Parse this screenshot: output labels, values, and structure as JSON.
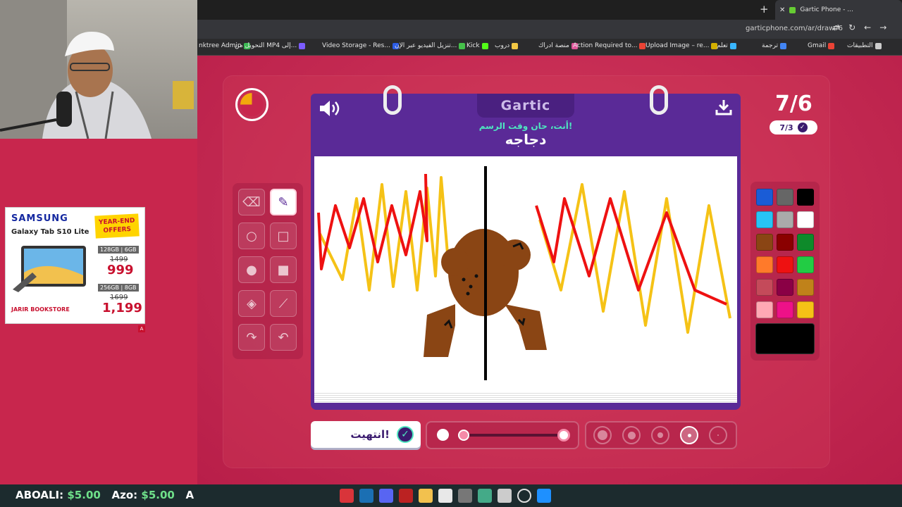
{
  "browser": {
    "tab_title": "Gartic Phone - ...",
    "url": "garticphone.com/ar/draw?6",
    "bookmarks": [
      {
        "label": "nktree Admin",
        "color": "#3cba54"
      },
      {
        "label": "التحويل من MP4 إلى...",
        "color": "#7b5cff"
      },
      {
        "label": "Video Storage - Res...",
        "color": "#2b5ce6"
      },
      {
        "label": "تنزيل الفيديو عبر الإن...",
        "color": "#45c14a"
      },
      {
        "label": "Kick",
        "color": "#53fc18"
      },
      {
        "label": "دروب",
        "color": "#f2c744"
      },
      {
        "label": "منصة ادراك",
        "color": "#e0569b"
      },
      {
        "label": "Action Required to...",
        "color": "#ea4335"
      },
      {
        "label": "Upload Image – re...",
        "color": "#d4b000"
      },
      {
        "label": "تعلم",
        "color": "#39b6ff"
      },
      {
        "label": "ترجمة",
        "color": "#4285f4"
      },
      {
        "label": "Gmail",
        "color": "#ea4335"
      },
      {
        "label": "التطبيقات",
        "color": "#cccccc"
      }
    ]
  },
  "game": {
    "logo": "Gartic",
    "prompt": "أنت، حان وقت الرسم!",
    "word": "دجاجه",
    "round": "7/6",
    "players_done": "7/3",
    "done_button": "انتهيت!",
    "timer_fraction": 0.25,
    "tools": [
      {
        "name": "eraser-tool",
        "icon": "eraser-icon",
        "glyph": "⌫",
        "active": false
      },
      {
        "name": "pencil-tool",
        "icon": "pencil-icon",
        "glyph": "✎",
        "active": true
      },
      {
        "name": "circle-outline-tool",
        "icon": "circle-outline-icon",
        "glyph": "○",
        "active": false
      },
      {
        "name": "rectangle-outline-tool",
        "icon": "square-outline-icon",
        "glyph": "□",
        "active": false
      },
      {
        "name": "circle-fill-tool",
        "icon": "circle-fill-icon",
        "glyph": "●",
        "active": false
      },
      {
        "name": "rectangle-fill-tool",
        "icon": "square-fill-icon",
        "glyph": "■",
        "active": false
      },
      {
        "name": "bucket-tool",
        "icon": "bucket-icon",
        "glyph": "◈",
        "active": false
      },
      {
        "name": "line-tool",
        "icon": "line-icon",
        "glyph": "⟋",
        "active": false
      },
      {
        "name": "redo-tool",
        "icon": "redo-icon",
        "glyph": "↷",
        "active": false
      },
      {
        "name": "undo-tool",
        "icon": "undo-icon",
        "glyph": "↶",
        "active": false
      }
    ],
    "palette": [
      "#1a5cd6",
      "#666666",
      "#000000",
      "#27c4f5",
      "#aaaaaa",
      "#ffffff",
      "#8a4514",
      "#8a0000",
      "#0e8a2a",
      "#ff7a2a",
      "#ee1111",
      "#22cc44",
      "#c44a5a",
      "#8a0045",
      "#c0821a",
      "#ffa8b4",
      "#ee1188",
      "#f5c216"
    ],
    "current_color": "#000000",
    "opacity_level": 0.04,
    "brush_sizes": [
      {
        "name": "brush-size-5",
        "dot": 14,
        "active": false
      },
      {
        "name": "brush-size-4",
        "dot": 11,
        "active": false
      },
      {
        "name": "brush-size-3",
        "dot": 8,
        "active": false
      },
      {
        "name": "brush-size-2",
        "dot": 5,
        "active": true
      },
      {
        "name": "brush-size-1",
        "dot": 2,
        "active": false
      }
    ]
  },
  "ad": {
    "brand": "SAMSUNG",
    "model": "Galaxy Tab S10 Lite",
    "badge": "YEAR-END OFFERS",
    "spec1": "128GB | 6GB",
    "old1": "1499",
    "price1": "999",
    "spec2": "256GB | 8GB",
    "old2": "1699",
    "price2": "1,199",
    "store": "JARIR BOOKSTORE",
    "flag": "A"
  },
  "taskbar": {
    "ticker_name": "ABOALI:",
    "ticker_amount": "$5.00",
    "ticker_name2": "Azo:",
    "ticker_amount2": "$5.00",
    "ticker_tail": "A"
  }
}
